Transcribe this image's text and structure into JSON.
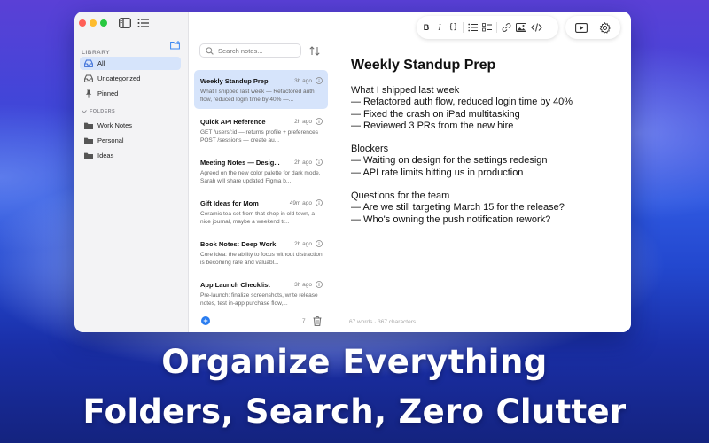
{
  "sidebar": {
    "library_label": "LIBRARY",
    "folders_label": "FOLDERS",
    "items": [
      {
        "label": "All",
        "icon": "tray-icon"
      },
      {
        "label": "Uncategorized",
        "icon": "tray-icon"
      },
      {
        "label": "Pinned",
        "icon": "pin-icon"
      }
    ],
    "folders": [
      {
        "label": "Work Notes",
        "icon": "folder-icon"
      },
      {
        "label": "Personal",
        "icon": "folder-icon"
      },
      {
        "label": "Ideas",
        "icon": "folder-icon"
      }
    ]
  },
  "notes_list": {
    "search_placeholder": "Search notes...",
    "count": "7",
    "notes": [
      {
        "title": "Weekly Standup Prep",
        "time": "3h ago",
        "snippet": "What I shipped last week — Refactored auth flow, reduced login time by 40% —..."
      },
      {
        "title": "Quick API Reference",
        "time": "2h ago",
        "snippet": "GET /users/:id — returns profile + preferences POST /sessions — create au..."
      },
      {
        "title": "Meeting Notes — Desig...",
        "time": "2h ago",
        "snippet": "Agreed on the new color palette for dark mode. Sarah will share updated Figma b..."
      },
      {
        "title": "Gift Ideas for Mom",
        "time": "49m ago",
        "snippet": "Ceramic tea set from that shop in old town, a nice journal, maybe a weekend tr..."
      },
      {
        "title": "Book Notes: Deep Work",
        "time": "2h ago",
        "snippet": "Core idea: the ability to focus without distraction is becoming rare and valuabl..."
      },
      {
        "title": "App Launch Checklist",
        "time": "3h ago",
        "snippet": "Pre-launch: finalize screenshots, write release notes, test in-app purchase flow,..."
      }
    ]
  },
  "toolbar": {
    "bold": "B",
    "italic": "I",
    "code_block": "{}",
    "link_icon": "link-icon",
    "image_icon": "image-icon",
    "code_icon": "code-icon",
    "preview_icon": "play-icon",
    "settings_icon": "gear-icon"
  },
  "editor": {
    "title": "Weekly Standup Prep",
    "sections": [
      {
        "heading": "What I shipped last week",
        "lines": [
          "— Refactored auth flow, reduced login time by 40%",
          "— Fixed the crash on iPad multitasking",
          "— Reviewed 3 PRs from the new hire"
        ]
      },
      {
        "heading": "Blockers",
        "lines": [
          "— Waiting on design for the settings redesign",
          "— API rate limits hitting us in production"
        ]
      },
      {
        "heading": "Questions for the team",
        "lines": [
          "— Are we still targeting March 15 for the release?",
          "— Who's owning the push notification rework?"
        ]
      }
    ],
    "stats": "67 words · 367 characters"
  },
  "tagline": {
    "line1": "Organize Everything",
    "line2": "Folders, Search, Zero Clutter"
  },
  "colors": {
    "accent": "#2a7df0",
    "selection": "#d6e4fb"
  }
}
